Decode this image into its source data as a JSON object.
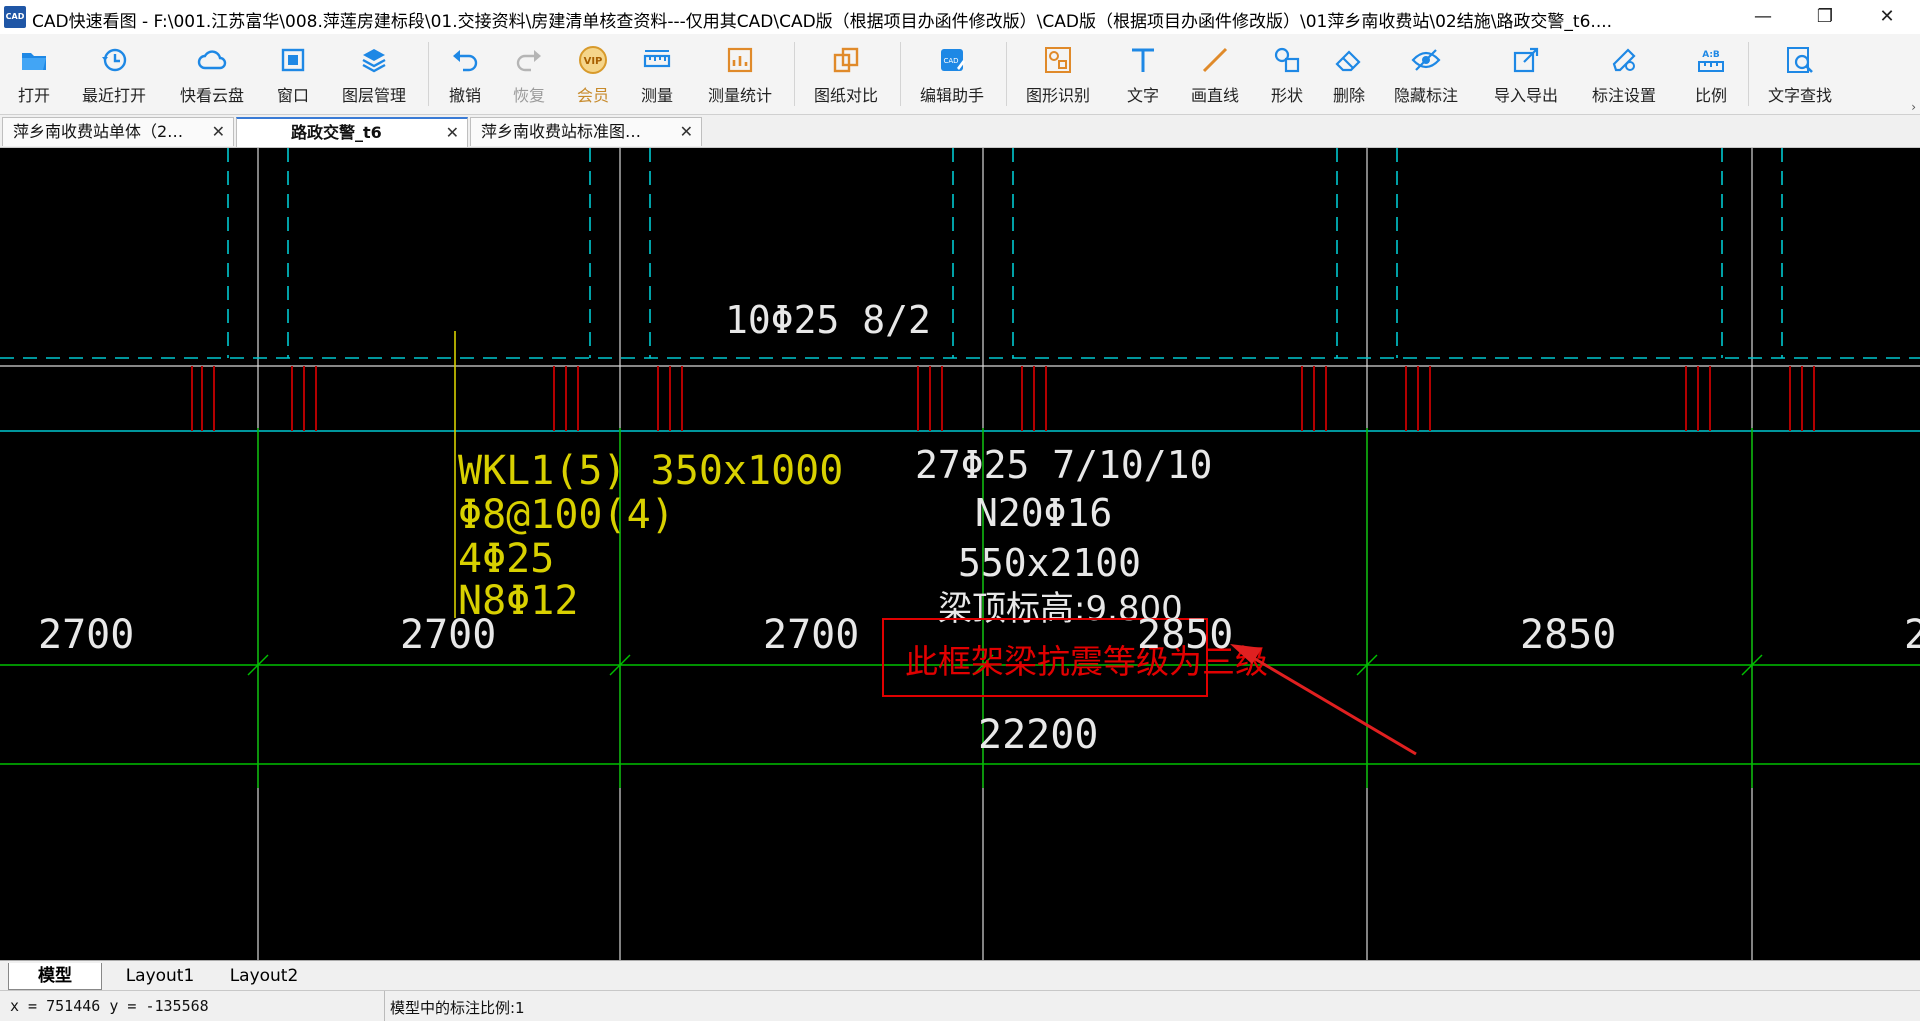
{
  "window": {
    "title": "CAD快速看图 - F:\\001.江苏富华\\008.萍莲房建标段\\01.交接资料\\房建清单核查资料---仅用其CAD\\CAD版（根据项目办函件修改版）\\CAD版（根据项目办函件修改版）\\01萍乡南收费站\\02结施\\路政交警_t6....",
    "app_icon_text": "CAD"
  },
  "toolbar": {
    "items": [
      {
        "label": "打开",
        "icon": "open-folder-icon"
      },
      {
        "label": "最近打开",
        "icon": "recent-clock-icon"
      },
      {
        "label": "快看云盘",
        "icon": "cloud-icon"
      },
      {
        "label": "窗口",
        "icon": "window-icon"
      },
      {
        "label": "图层管理",
        "icon": "layers-icon"
      },
      {
        "label": "撤销",
        "icon": "undo-icon"
      },
      {
        "label": "恢复",
        "icon": "redo-icon"
      },
      {
        "label": "会员",
        "icon": "vip-icon",
        "badge": "VIP"
      },
      {
        "label": "测量",
        "icon": "ruler-icon"
      },
      {
        "label": "测量统计",
        "icon": "measure-stats-icon"
      },
      {
        "label": "图纸对比",
        "icon": "compare-icon"
      },
      {
        "label": "编辑助手",
        "icon": "edit-assistant-icon"
      },
      {
        "label": "图形识别",
        "icon": "shape-recognize-icon"
      },
      {
        "label": "文字",
        "icon": "text-icon"
      },
      {
        "label": "画直线",
        "icon": "line-icon"
      },
      {
        "label": "形状",
        "icon": "shapes-icon"
      },
      {
        "label": "删除",
        "icon": "eraser-icon"
      },
      {
        "label": "隐藏标注",
        "icon": "hide-eye-icon"
      },
      {
        "label": "导入导出",
        "icon": "import-export-icon"
      },
      {
        "label": "标注设置",
        "icon": "annotation-settings-icon"
      },
      {
        "label": "比例",
        "icon": "scale-icon",
        "badge": "A:B"
      },
      {
        "label": "文字查找",
        "icon": "text-search-icon"
      }
    ]
  },
  "tabs": [
    {
      "label": "萍乡南收费站单体（2…",
      "close": "✕"
    },
    {
      "label": "路政交警_t6",
      "close": "✕"
    },
    {
      "label": "萍乡南收费站标准图…",
      "close": "✕"
    }
  ],
  "drawing": {
    "top_rebar": "10Φ25 8/2",
    "beam_label": {
      "line1": "WKL1(5) 350x1000",
      "line2": "Φ8@100(4)",
      "line3": "4Φ25",
      "line4": "N8Φ12"
    },
    "center_label": {
      "line1": "27Φ25 7/10/10",
      "line2": "N20Φ16",
      "line3": "550x2100",
      "line4": "梁顶标高:9.800"
    },
    "note": "此框架梁抗震等级为三级",
    "dimensions": [
      "2700",
      "2700",
      "2700",
      "2850",
      "2850",
      "2"
    ],
    "total_dimension": "22200",
    "colors": {
      "background": "#000000",
      "grid_white": "#d8d8d8",
      "cyan": "#00c8d0",
      "red_rebar": "#b30000",
      "yellow_text": "#d8d000",
      "green_dim": "#00c000",
      "note_red": "#e00000"
    }
  },
  "layout_tabs": [
    "模型",
    "Layout1",
    "Layout2"
  ],
  "status": {
    "coords": "x = 751446  y = -135568",
    "scale_text": "模型中的标注比例:1"
  }
}
